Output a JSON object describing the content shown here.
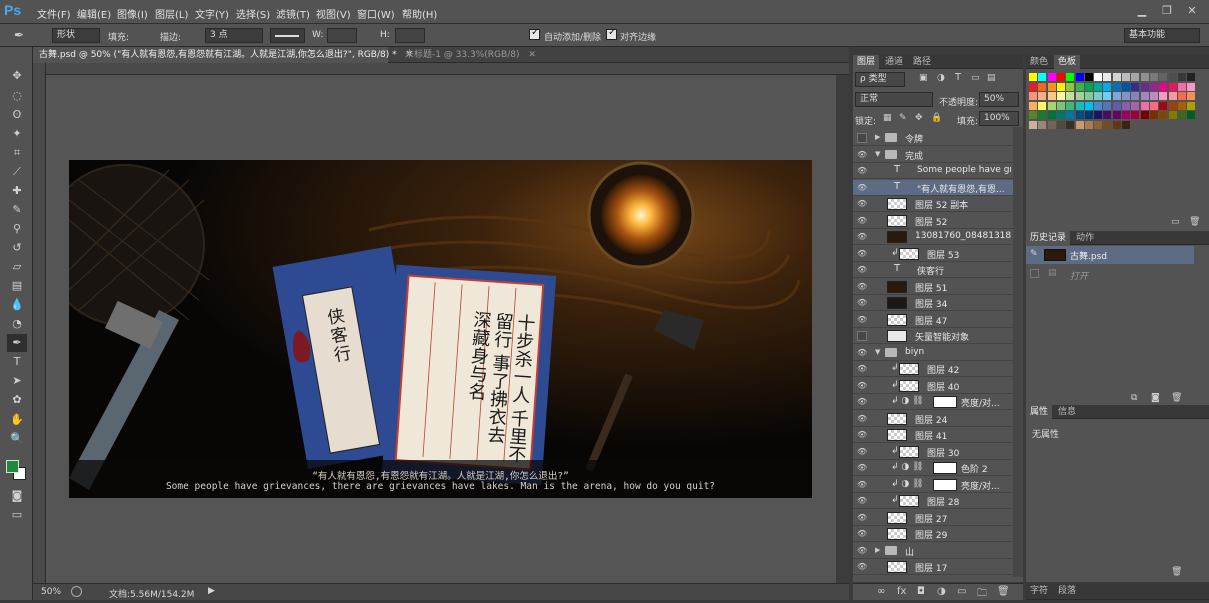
{
  "app": {
    "logo": "Ps"
  },
  "menu": [
    "文件(F)",
    "编辑(E)",
    "图像(I)",
    "图层(L)",
    "文字(Y)",
    "选择(S)",
    "滤镜(T)",
    "视图(V)",
    "窗口(W)",
    "帮助(H)"
  ],
  "window_controls": {
    "minimize": "▁",
    "restore": "❐",
    "close": "✕"
  },
  "options": {
    "shape_mode": "形状",
    "fill_label": "填充:",
    "stroke_label": "描边:",
    "stroke_size": "3 点",
    "w_label": "W:",
    "h_label": "H:",
    "auto_add_label": "自动添加/删除",
    "align_edges_label": "对齐边缘",
    "workspace": "基本功能"
  },
  "doc_tabs": [
    {
      "label": "古舞.psd @ 50% (\"有人就有恩怨,有恩怨就有江湖。人就是江湖,你怎么退出?\", RGB/8) *",
      "close": "✕"
    },
    {
      "label": "未标题-1 @ 33.3%(RGB/8)",
      "close": "✕"
    }
  ],
  "canvas": {
    "title_cn": "侠客行",
    "poem": "十步杀一人 千里不留行 事了拂衣去 深藏身与名",
    "caption_cn": "“有人就有恩怨,有恩怨就有江湖。人就是江湖,你怎么退出?”",
    "caption_en": "Some people have grievances, there are grievances have lakes. Man is the arena, how do you quit?"
  },
  "status": {
    "zoom": "50%",
    "doc_info": "文档:5.56M/154.2M"
  },
  "layers_panel": {
    "tabs": [
      "图层",
      "通道",
      "路径"
    ],
    "filter": "ρ 类型",
    "blend_mode": "正常",
    "opacity_label": "不透明度:",
    "opacity": "50%",
    "lock_label": "锁定:",
    "fill_label": "填充:",
    "fill": "100%",
    "layers": [
      {
        "name": "令牌",
        "kind": "group",
        "visible": false
      },
      {
        "name": "完成",
        "kind": "group-open",
        "visible": true
      },
      {
        "name": "Some people have gri...",
        "kind": "text",
        "visible": true
      },
      {
        "name": "\"有人就有恩怨,有恩...",
        "kind": "text",
        "visible": true,
        "selected": true
      },
      {
        "name": "图层 52 副本",
        "kind": "pixel",
        "visible": true
      },
      {
        "name": "图层 52",
        "kind": "pixel",
        "visible": true
      },
      {
        "name": "13081760_08481318...",
        "kind": "photo",
        "visible": true
      },
      {
        "name": "图层 53",
        "kind": "pixel-clip",
        "visible": true
      },
      {
        "name": "侠客行",
        "kind": "text",
        "visible": true
      },
      {
        "name": "图层 51",
        "kind": "photo",
        "visible": true
      },
      {
        "name": "图层 34",
        "kind": "dark",
        "visible": true
      },
      {
        "name": "图层 47",
        "kind": "pixel",
        "visible": true
      },
      {
        "name": "矢量智能对象",
        "kind": "smart",
        "visible": false
      },
      {
        "name": "biyn",
        "kind": "group-open",
        "visible": true
      },
      {
        "name": "图层 42",
        "kind": "pixel-clip",
        "visible": true
      },
      {
        "name": "图层 40",
        "kind": "pixel-clip",
        "visible": true
      },
      {
        "name": "亮度/对...",
        "kind": "adjust",
        "visible": true
      },
      {
        "name": "图层 24",
        "kind": "pixel",
        "visible": true
      },
      {
        "name": "图层 41",
        "kind": "pixel",
        "visible": true
      },
      {
        "name": "图层 30",
        "kind": "pixel-clip",
        "visible": true
      },
      {
        "name": "色阶 2",
        "kind": "adjust",
        "visible": true
      },
      {
        "name": "亮度/对...",
        "kind": "adjust",
        "visible": true
      },
      {
        "name": "图层 28",
        "kind": "pixel-clip",
        "visible": true
      },
      {
        "name": "图层 27",
        "kind": "pixel",
        "visible": true
      },
      {
        "name": "图层 29",
        "kind": "pixel",
        "visible": true
      },
      {
        "name": "山",
        "kind": "group",
        "visible": true
      },
      {
        "name": "图层 17",
        "kind": "pixel",
        "visible": true
      }
    ],
    "footer_icons": [
      "∞",
      "fx",
      "◘",
      "◑",
      "▭",
      "🗀",
      "🗑"
    ]
  },
  "swatches_panel": {
    "tabs": [
      "颜色",
      "色板"
    ]
  },
  "history_panel": {
    "tabs": [
      "历史记录",
      "动作"
    ],
    "items": [
      {
        "label": "古舞.psd"
      },
      {
        "label": "打开"
      }
    ]
  },
  "properties_panel": {
    "tabs": [
      "属性",
      "信息"
    ],
    "empty_text": "无属性"
  },
  "bottom_tabs": [
    "字符",
    "段落"
  ],
  "colors": {
    "accent": "#4aa7f0",
    "foreground": "#1f8a3c",
    "background": "#ffffff",
    "selection": "#5d6c84"
  }
}
